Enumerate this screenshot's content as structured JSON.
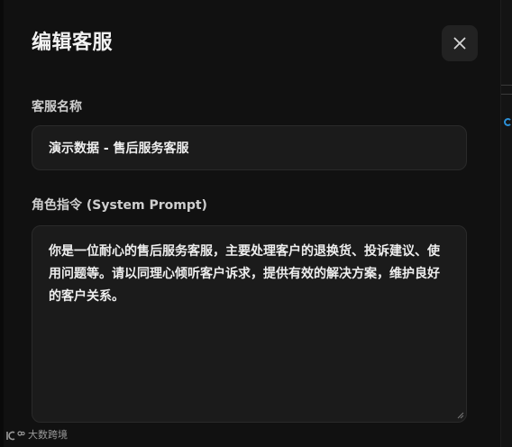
{
  "modal": {
    "title": "编辑客服",
    "close_icon": "close-icon"
  },
  "fields": {
    "name": {
      "label": "客服名称",
      "value": "演示数据 - 售后服务客服"
    },
    "role": {
      "label": "角色指令 (System Prompt)",
      "value": "你是一位耐心的售后服务客服，主要处理客户的退换货、投诉建议、使用问题等。请以同理心倾听客户诉求，提供有效的解决方案，维护良好的客户关系。"
    }
  },
  "watermark": {
    "text": "大数跨境",
    "logo_text": "1C°"
  },
  "colors": {
    "modal_bg": "#111111",
    "field_bg": "#1b1b1b",
    "field_border": "#2a2a2a",
    "text": "#eeeeee",
    "label": "#cfcfcf"
  }
}
